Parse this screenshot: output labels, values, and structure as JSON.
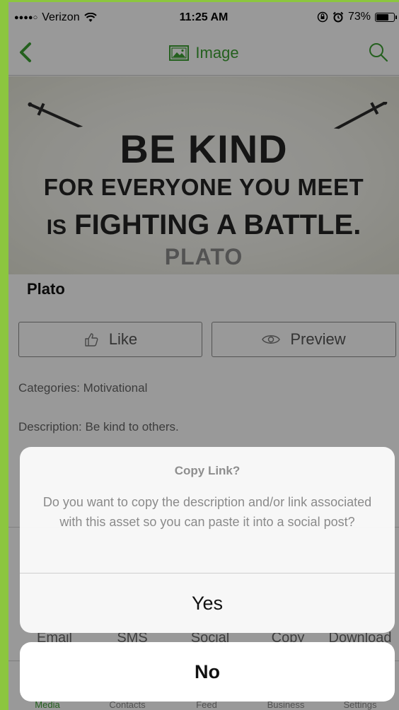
{
  "status_bar": {
    "signal": "●●●●○",
    "carrier": "Verizon",
    "time": "11:25 AM",
    "battery": "73%",
    "battery_level": 0.73
  },
  "nav": {
    "title": "Image",
    "back_icon": "chevron-left-icon",
    "title_icon": "image-icon",
    "search_icon": "search-icon"
  },
  "hero": {
    "line1": "BE KIND",
    "line2": "FOR EVERYONE YOU MEET",
    "line3_prefix": "IS",
    "line3_main": "FIGHTING A BATTLE.",
    "line4": "PLATO"
  },
  "asset": {
    "title": "Plato",
    "like_label": "Like",
    "preview_label": "Preview",
    "categories": "Categories: Motivational",
    "description": "Description: Be kind to others."
  },
  "share": {
    "items": [
      "Email",
      "SMS",
      "Social",
      "Copy",
      "Download"
    ]
  },
  "tabbar": {
    "items": [
      "Media",
      "Contacts",
      "Feed",
      "Business",
      "Settings"
    ],
    "active": "Media"
  },
  "alert": {
    "title": "Copy Link?",
    "message": "Do you want to copy the description and/or link associated with this asset so you can paste it into a social post?",
    "confirm_label": "Yes",
    "cancel_label": "No"
  },
  "colors": {
    "accent": "#3da033",
    "frame": "#8cc63f"
  }
}
